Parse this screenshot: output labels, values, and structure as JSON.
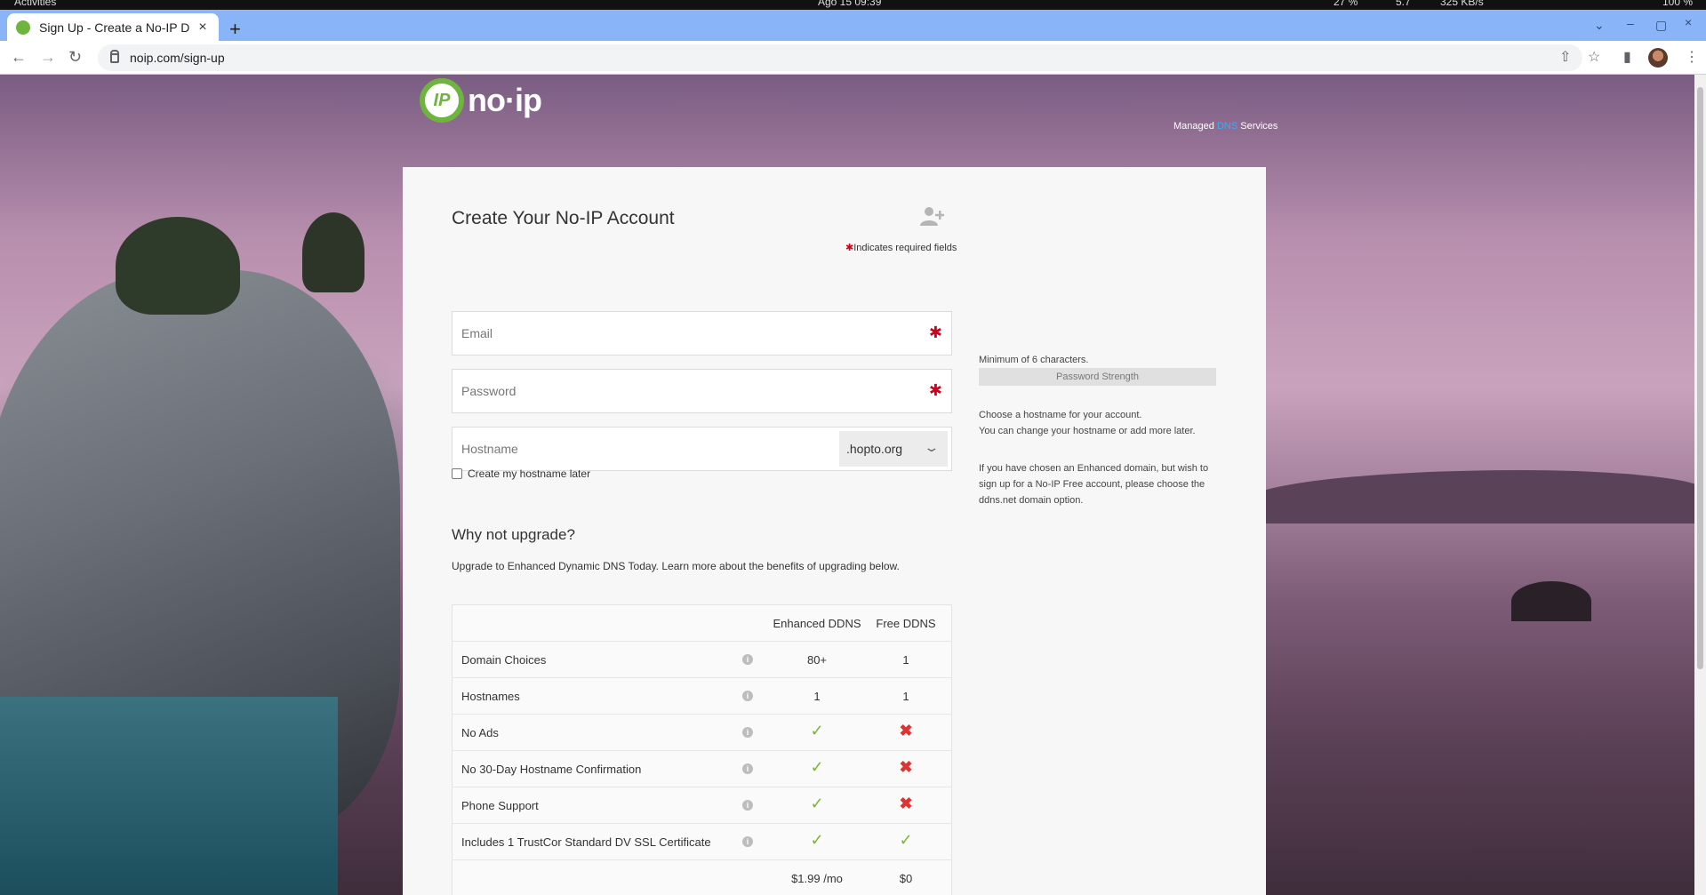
{
  "system_bar": {
    "activities": "Activities",
    "clock": "Ago 15 09:39",
    "cpu": "27 %",
    "temp": "5.7",
    "net": "325 KB/s",
    "battery": "100 %"
  },
  "browser": {
    "tab_title": "Sign Up - Create a No-IP D",
    "url": "noip.com/sign-up"
  },
  "header": {
    "logo_text": "no·ip",
    "tagline_pre": "Managed",
    "tagline_dns": "DNS",
    "tagline_post": "Services"
  },
  "form": {
    "title": "Create Your No-IP Account",
    "required_note": "Indicates required fields",
    "email_placeholder": "Email",
    "password_placeholder": "Password",
    "hostname_placeholder": "Hostname",
    "domain_selected": ".hopto.org",
    "create_later_label": "Create my hostname later"
  },
  "help": {
    "password_min": "Minimum of 6 characters.",
    "password_strength": "Password Strength",
    "hostname_line1": "Choose a hostname for your account.",
    "hostname_line2": "You can change your hostname or add more later.",
    "enhanced_note": "If you have chosen an Enhanced domain, but wish to sign up for a No-IP Free account, please choose the ddns.net domain option."
  },
  "upgrade": {
    "title": "Why not upgrade?",
    "text": "Upgrade to Enhanced Dynamic DNS Today. Learn more about the benefits of upgrading below.",
    "col_enhanced": "Enhanced DDNS",
    "col_free": "Free DDNS",
    "rows": [
      {
        "feature": "Domain Choices",
        "enhanced": "80+",
        "free": "1"
      },
      {
        "feature": "Hostnames",
        "enhanced": "1",
        "free": "1"
      },
      {
        "feature": "No Ads",
        "enhanced": "✓",
        "free": "✖"
      },
      {
        "feature": "No 30-Day Hostname Confirmation",
        "enhanced": "✓",
        "free": "✖"
      },
      {
        "feature": "Phone Support",
        "enhanced": "✓",
        "free": "✖"
      },
      {
        "feature": "Includes 1 TrustCor Standard DV SSL Certificate",
        "enhanced": "✓",
        "free": "✓"
      }
    ],
    "price_enhanced": "$1.99 /mo",
    "price_free": "$0"
  },
  "icons": {
    "info": "i",
    "close": "×",
    "new_tab": "+",
    "back": "←",
    "forward": "→",
    "reload": "↻",
    "share": "⇧",
    "star": "☆",
    "menu": "⋮",
    "chevron": "⌄",
    "required": "✱"
  }
}
